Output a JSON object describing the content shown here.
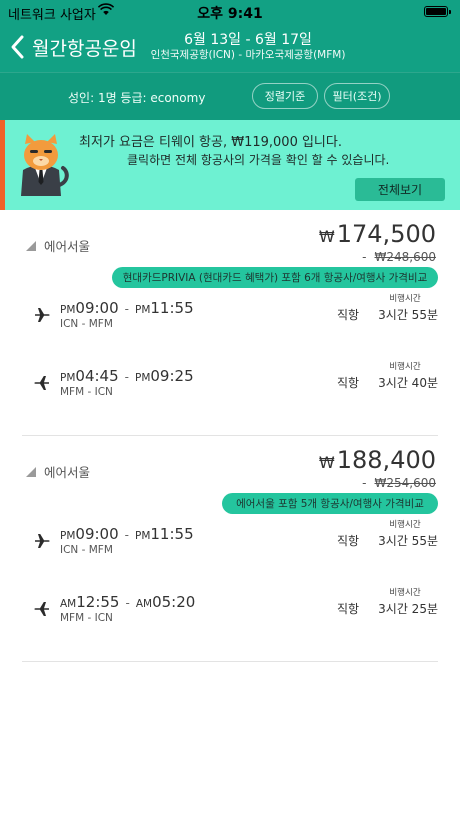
{
  "status_bar": {
    "carrier": "네트워크 사업자",
    "time": "오후 9:41"
  },
  "nav": {
    "back_title": "월간항공운임",
    "dates": "6월 13일 - 6월 17일",
    "airports": "인천국제공항(ICN) - 마카오국제공항(MFM)"
  },
  "filter_bar": {
    "passenger_info": "성인: 1명 등급: economy",
    "sort_label": "정렬기준",
    "filter_label": "필터(조건)"
  },
  "banner": {
    "line1": "최저가 요금은 티웨이 항공, ₩119,000 입니다.",
    "line2": "클릭하면 전체 항공사의 가격을 확인 할 수 있습니다.",
    "button": "전체보기"
  },
  "results": [
    {
      "airline": "에어서울",
      "currency": "₩",
      "price": "174,500",
      "original_price": "₩248,600",
      "compare_text": "현대카드PRIVIA (현대카드 혜택가) 포함 6개 항공사/여행사 가격비교",
      "legs": [
        {
          "dep_ampm": "PM",
          "dep_time": "09:00",
          "arr_ampm": "PM",
          "arr_time": "11:55",
          "route": "ICN - MFM",
          "type": "직항",
          "duration_label": "비행시간",
          "duration": "3시간 55분"
        },
        {
          "dep_ampm": "PM",
          "dep_time": "04:45",
          "arr_ampm": "PM",
          "arr_time": "09:25",
          "route": "MFM - ICN",
          "type": "직항",
          "duration_label": "비행시간",
          "duration": "3시간 40분"
        }
      ]
    },
    {
      "airline": "에어서울",
      "currency": "₩",
      "price": "188,400",
      "original_price": "₩254,600",
      "compare_text": "에어서울 포함 5개 항공사/여행사 가격비교",
      "legs": [
        {
          "dep_ampm": "PM",
          "dep_time": "09:00",
          "arr_ampm": "PM",
          "arr_time": "11:55",
          "route": "ICN - MFM",
          "type": "직항",
          "duration_label": "비행시간",
          "duration": "3시간 55분"
        },
        {
          "dep_ampm": "AM",
          "dep_time": "12:55",
          "arr_ampm": "AM",
          "arr_time": "05:20",
          "route": "MFM - ICN",
          "type": "직항",
          "duration_label": "비행시간",
          "duration": "3시간 25분"
        }
      ]
    }
  ],
  "colors": {
    "header": "#12a184",
    "banner": "#6ef1d2",
    "accent": "#24c59e",
    "banner_edge": "#f0622a"
  }
}
